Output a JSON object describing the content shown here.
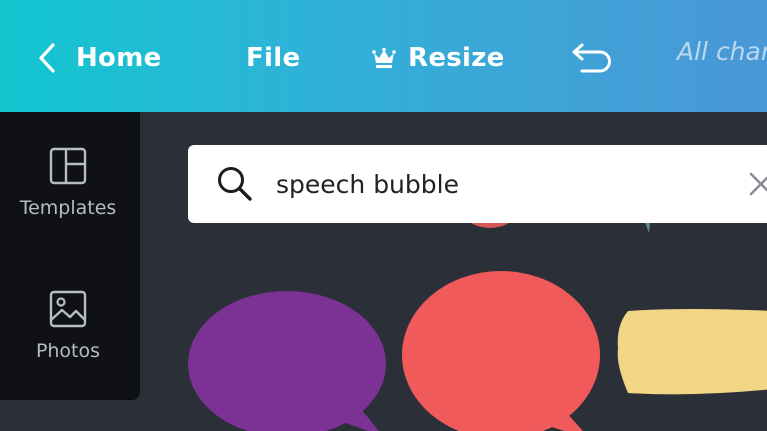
{
  "topbar": {
    "home_label": "Home",
    "file_label": "File",
    "resize_label": "Resize",
    "status_text": "All changes saved",
    "icons": {
      "back": "chevron-left-icon",
      "resize": "crown-icon",
      "undo": "undo-icon"
    },
    "gradient": [
      "#12c6cf",
      "#4a97d6"
    ]
  },
  "sidebar": {
    "items": [
      {
        "label": "Templates",
        "icon": "templates-icon"
      },
      {
        "label": "Photos",
        "icon": "photos-icon"
      }
    ]
  },
  "search": {
    "value": "speech bubble",
    "icons": {
      "search": "search-icon",
      "clear": "close-icon"
    }
  },
  "results": {
    "items": [
      {
        "name": "speech-bubble-purple",
        "color": "#7b3294"
      },
      {
        "name": "speech-bubble-red",
        "color": "#f05a5b"
      },
      {
        "name": "speech-bubble-yellow",
        "color": "#f2d585"
      }
    ]
  }
}
